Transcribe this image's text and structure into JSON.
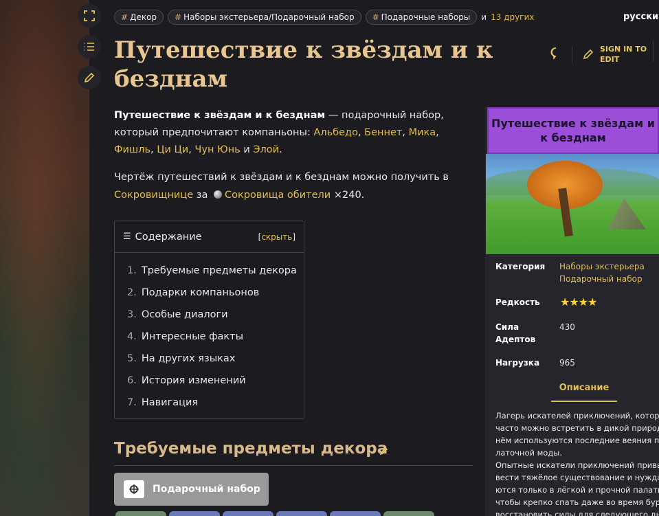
{
  "tags": [
    {
      "label": "Декор"
    },
    {
      "label": "Наборы экстерьера/Подарочный набор"
    },
    {
      "label": "Подарочные наборы"
    }
  ],
  "tags_and": "и",
  "tags_more": "13 других",
  "language": "русский",
  "title": "Путешествие к звёздам и к безднам",
  "sign_in": {
    "line1": "SIGN IN TO",
    "line2": "EDIT"
  },
  "intro": {
    "bold": "Путешествие к звёздам и к безднам",
    "text1": " — подарочный набор, который предпочитают компаньоны: ",
    "companions": [
      "Альбедо",
      "Беннет",
      "Мика",
      "Фишль",
      "Ци Ци",
      "Чун Юнь",
      "Элой"
    ],
    "and": "и",
    "end": "."
  },
  "para2": {
    "text1": "Чертёж путешествий к звёздам и к безднам можно получить в ",
    "link1": "Сокровищнице",
    "text2": " за ",
    "link2": "Сокровища обители",
    "text3": " ×240."
  },
  "toc": {
    "title": "Содержание",
    "hide": "скрыть",
    "items": [
      {
        "num": "1.",
        "label": "Требуемые предметы декора"
      },
      {
        "num": "2.",
        "label": "Подарки компаньонов"
      },
      {
        "num": "3.",
        "label": "Особые диалоги"
      },
      {
        "num": "4.",
        "label": "Интересные факты"
      },
      {
        "num": "5.",
        "label": "На других языках"
      },
      {
        "num": "6.",
        "label": "История изменений"
      },
      {
        "num": "7.",
        "label": "Навигация"
      }
    ]
  },
  "section_heading": "Требуемые предметы декора",
  "gift_button": "Подарочный набор",
  "infobox": {
    "title": "Путешествие к звёздам и к безднам",
    "category_label": "Категория",
    "category_value1": "Наборы экстерьера",
    "category_value2": "Подарочный набор",
    "rarity_label": "Редкость",
    "rarity_stars": 4,
    "adeptal_label1": "Сила",
    "adeptal_label2": "Адептов",
    "adeptal_value": "430",
    "load_label": "Нагрузка",
    "load_value": "965",
    "tab": "Описание",
    "desc_lines": [
      "Лагерь искателей приключений, который",
      "часто можно встретить в дикой природе. В",
      "нём используются последние веяния па-",
      "латочной моды.",
      "Опытные искатели приключений привык-",
      "вести тяжёлое существование и нужда-",
      "ются только в лёгкой и прочной палатке,",
      "чтобы крепко спать даже во время бури и",
      "восстановить силы для следующего дня"
    ]
  },
  "colors": {
    "accent": "#e1bd52",
    "title": "#e7c68f",
    "infobox_header": "#9b4fd8"
  }
}
